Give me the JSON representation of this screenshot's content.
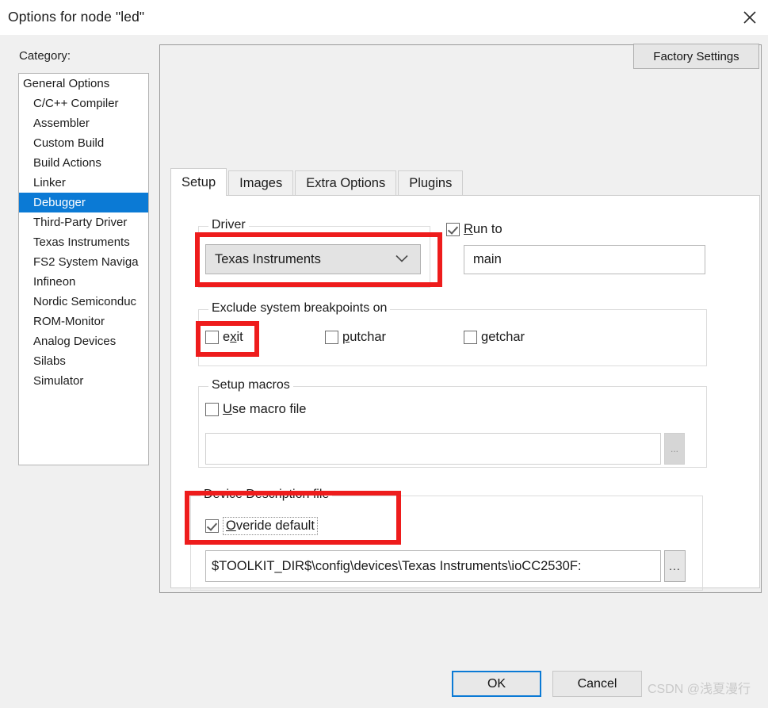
{
  "window": {
    "title": "Options for node \"led\"",
    "close_icon": "close-icon"
  },
  "sidebar": {
    "label": "Category:",
    "items": [
      {
        "label": "General Options",
        "indent": false,
        "selected": false
      },
      {
        "label": "C/C++ Compiler",
        "indent": true,
        "selected": false
      },
      {
        "label": "Assembler",
        "indent": true,
        "selected": false
      },
      {
        "label": "Custom Build",
        "indent": true,
        "selected": false
      },
      {
        "label": "Build Actions",
        "indent": true,
        "selected": false
      },
      {
        "label": "Linker",
        "indent": true,
        "selected": false
      },
      {
        "label": "Debugger",
        "indent": true,
        "selected": true
      },
      {
        "label": "Third-Party Driver",
        "indent": true,
        "selected": false
      },
      {
        "label": "Texas Instruments",
        "indent": true,
        "selected": false
      },
      {
        "label": "FS2 System Naviga",
        "indent": true,
        "selected": false
      },
      {
        "label": "Infineon",
        "indent": true,
        "selected": false
      },
      {
        "label": "Nordic Semiconduc",
        "indent": true,
        "selected": false
      },
      {
        "label": "ROM-Monitor",
        "indent": true,
        "selected": false
      },
      {
        "label": "Analog Devices",
        "indent": true,
        "selected": false
      },
      {
        "label": "Silabs",
        "indent": true,
        "selected": false
      },
      {
        "label": "Simulator",
        "indent": true,
        "selected": false
      }
    ]
  },
  "panel": {
    "factory_settings_label": "Factory Settings",
    "tabs": [
      {
        "label": "Setup",
        "active": true
      },
      {
        "label": "Images",
        "active": false
      },
      {
        "label": "Extra Options",
        "active": false
      },
      {
        "label": "Plugins",
        "active": false
      }
    ]
  },
  "setup": {
    "driver": {
      "group_title": "Driver",
      "selected": "Texas Instruments",
      "chevron_icon": "chevron-down-icon"
    },
    "run_to": {
      "label": "Run to",
      "accel": "R",
      "checked": true,
      "value": "main"
    },
    "exclude_breakpoints": {
      "group_title": "Exclude system breakpoints on",
      "items": [
        {
          "label_before": "e",
          "accel": "x",
          "label_after": "it",
          "checked": false
        },
        {
          "label_before": "",
          "accel": "p",
          "label_after": "utchar",
          "checked": false
        },
        {
          "label_before": "",
          "accel": "g",
          "label_after": "etchar",
          "checked": false
        }
      ]
    },
    "setup_macros": {
      "group_title": "Setup macros",
      "use_macro_file": {
        "accel": "U",
        "label_after": "se macro file",
        "checked": false
      },
      "macro_file_value": "",
      "browse_label": "..."
    },
    "device_description": {
      "group_title": "Device Description file",
      "overide_default": {
        "accel": "O",
        "label_after": "veride default",
        "checked": true
      },
      "path_value": "$TOOLKIT_DIR$\\config\\devices\\Texas Instruments\\ioCC2530F:",
      "browse_label": "..."
    }
  },
  "footer": {
    "ok_label": "OK",
    "cancel_label": "Cancel",
    "watermark": "CSDN @浅夏漫行"
  },
  "colors": {
    "selection_blue": "#0b7ad5",
    "annotation_red": "#ee1c1c",
    "dialog_gray": "#f0f0f0"
  }
}
